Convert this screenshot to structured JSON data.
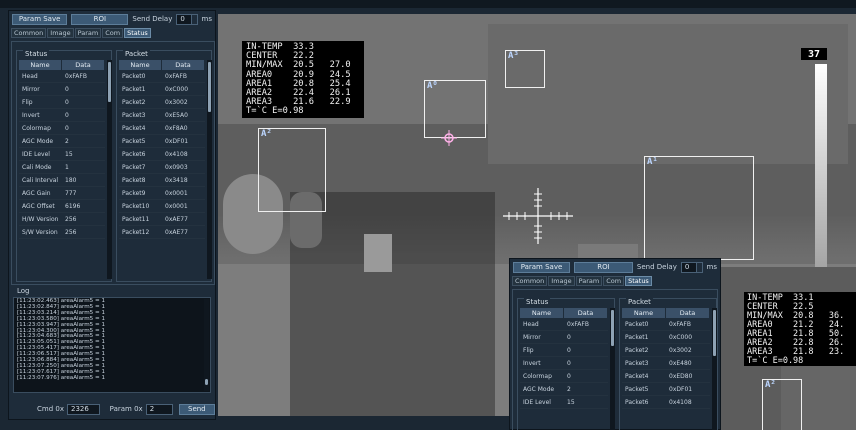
{
  "toolbar": {
    "param_save_label": "Param Save",
    "roi_label": "ROI",
    "send_delay_label": "Send Delay",
    "send_delay_value": "0",
    "delay_unit": "ms"
  },
  "tabs": [
    "Common",
    "Image",
    "Param",
    "Com",
    "Status"
  ],
  "status_group": {
    "title": "Status",
    "columns": [
      "Name",
      "Data"
    ],
    "rows": [
      [
        "Head",
        "0xFAFB"
      ],
      [
        "Mirror",
        "0"
      ],
      [
        "Flip",
        "0"
      ],
      [
        "Invert",
        "0"
      ],
      [
        "Colormap",
        "0"
      ],
      [
        "AGC Mode",
        "2"
      ],
      [
        "IDE Level",
        "15"
      ],
      [
        "Cali Mode",
        "1"
      ],
      [
        "Cali Interval",
        "180"
      ],
      [
        "AGC Gain",
        "777"
      ],
      [
        "AGC Offset",
        "6196"
      ],
      [
        "H/W Version",
        "256"
      ],
      [
        "S/W Version",
        "256"
      ]
    ]
  },
  "packet_group": {
    "title": "Packet",
    "columns": [
      "Name",
      "Data"
    ],
    "rows": [
      [
        "Packet0",
        "0xFAFB"
      ],
      [
        "Packet1",
        "0xC000"
      ],
      [
        "Packet2",
        "0x3002"
      ],
      [
        "Packet3",
        "0xE5A0"
      ],
      [
        "Packet4",
        "0xF8A0"
      ],
      [
        "Packet5",
        "0xDF01"
      ],
      [
        "Packet6",
        "0x4108"
      ],
      [
        "Packet7",
        "0x0903"
      ],
      [
        "Packet8",
        "0x3418"
      ],
      [
        "Packet9",
        "0x0001"
      ],
      [
        "Packet10",
        "0x0001"
      ],
      [
        "Packet11",
        "0xAE77"
      ],
      [
        "Packet12",
        "0xAE77"
      ]
    ]
  },
  "log": {
    "title": "Log",
    "lines": [
      "[11:23:02.463] areaAlarm5 = 1",
      "[11:23:02.847] areaAlarm5 = 1",
      "[11:23:03.214] areaAlarm5 = 1",
      "[11:23:03.580] areaAlarm5 = 1",
      "[11:23:03.947] areaAlarm5 = 1",
      "[11:23:04.300] areaAlarm5 = 1",
      "[11:23:04.683] areaAlarm5 = 1",
      "[11:23:05.051] areaAlarm5 = 1",
      "[11:23:05.417] areaAlarm5 = 1",
      "[11:23:06.517] areaAlarm5 = 1",
      "[11:23:06.884] areaAlarm5 = 1",
      "[11:23:07.250] areaAlarm5 = 1",
      "[11:23:07.617] areaAlarm5 = 1",
      "[11:23:07.976] areaAlarm5 = 1"
    ]
  },
  "command": {
    "cmd_label": "Cmd 0x",
    "cmd_value": "2326",
    "param_label": "Param 0x",
    "param_value": "2",
    "send_label": "Send"
  },
  "readout_main": [
    "IN-TEMP  33.3",
    "CENTER   22.2",
    "MIN/MAX  20.5   27.0",
    "AREA0    20.9   24.5",
    "AREA1    20.8   25.4",
    "AREA2    22.4   26.1",
    "AREA3    21.6   22.9",
    "T=`C E=0.98"
  ],
  "readout_second": [
    "IN-TEMP  33.1",
    "CENTER   22.5",
    "MIN/MAX  20.8   36.",
    "AREA0    21.2   24.",
    "AREA1    21.8   50.",
    "AREA2    22.8   26.",
    "AREA3    21.8   23.",
    "T=`C E=0.98"
  ],
  "roi_labels": [
    "A³",
    "A⁰",
    "A²",
    "A¹"
  ],
  "scale_label": "37",
  "second_window": {
    "param_save_label": "Param Save",
    "roi_label": "ROI",
    "send_delay_label": "Send Delay",
    "send_delay_value": "0",
    "delay_unit": "ms",
    "tabs": [
      "Common",
      "Image",
      "Param",
      "Com",
      "Status"
    ],
    "status_title": "Status",
    "packet_title": "Packet",
    "columns": [
      "Name",
      "Data"
    ],
    "status_rows": [
      [
        "Head",
        "0xFAFB"
      ],
      [
        "Mirror",
        "0"
      ],
      [
        "Flip",
        "0"
      ],
      [
        "Invert",
        "0"
      ],
      [
        "Colormap",
        "0"
      ],
      [
        "AGC Mode",
        "2"
      ],
      [
        "IDE Level",
        "15"
      ]
    ],
    "packet_rows": [
      [
        "Packet0",
        "0xFAFB"
      ],
      [
        "Packet1",
        "0xC000"
      ],
      [
        "Packet2",
        "0x3002"
      ],
      [
        "Packet3",
        "0xE480"
      ],
      [
        "Packet4",
        "0xED80"
      ],
      [
        "Packet5",
        "0xDF01"
      ],
      [
        "Packet6",
        "0x4108"
      ]
    ],
    "roi_label_a2": "A²"
  }
}
